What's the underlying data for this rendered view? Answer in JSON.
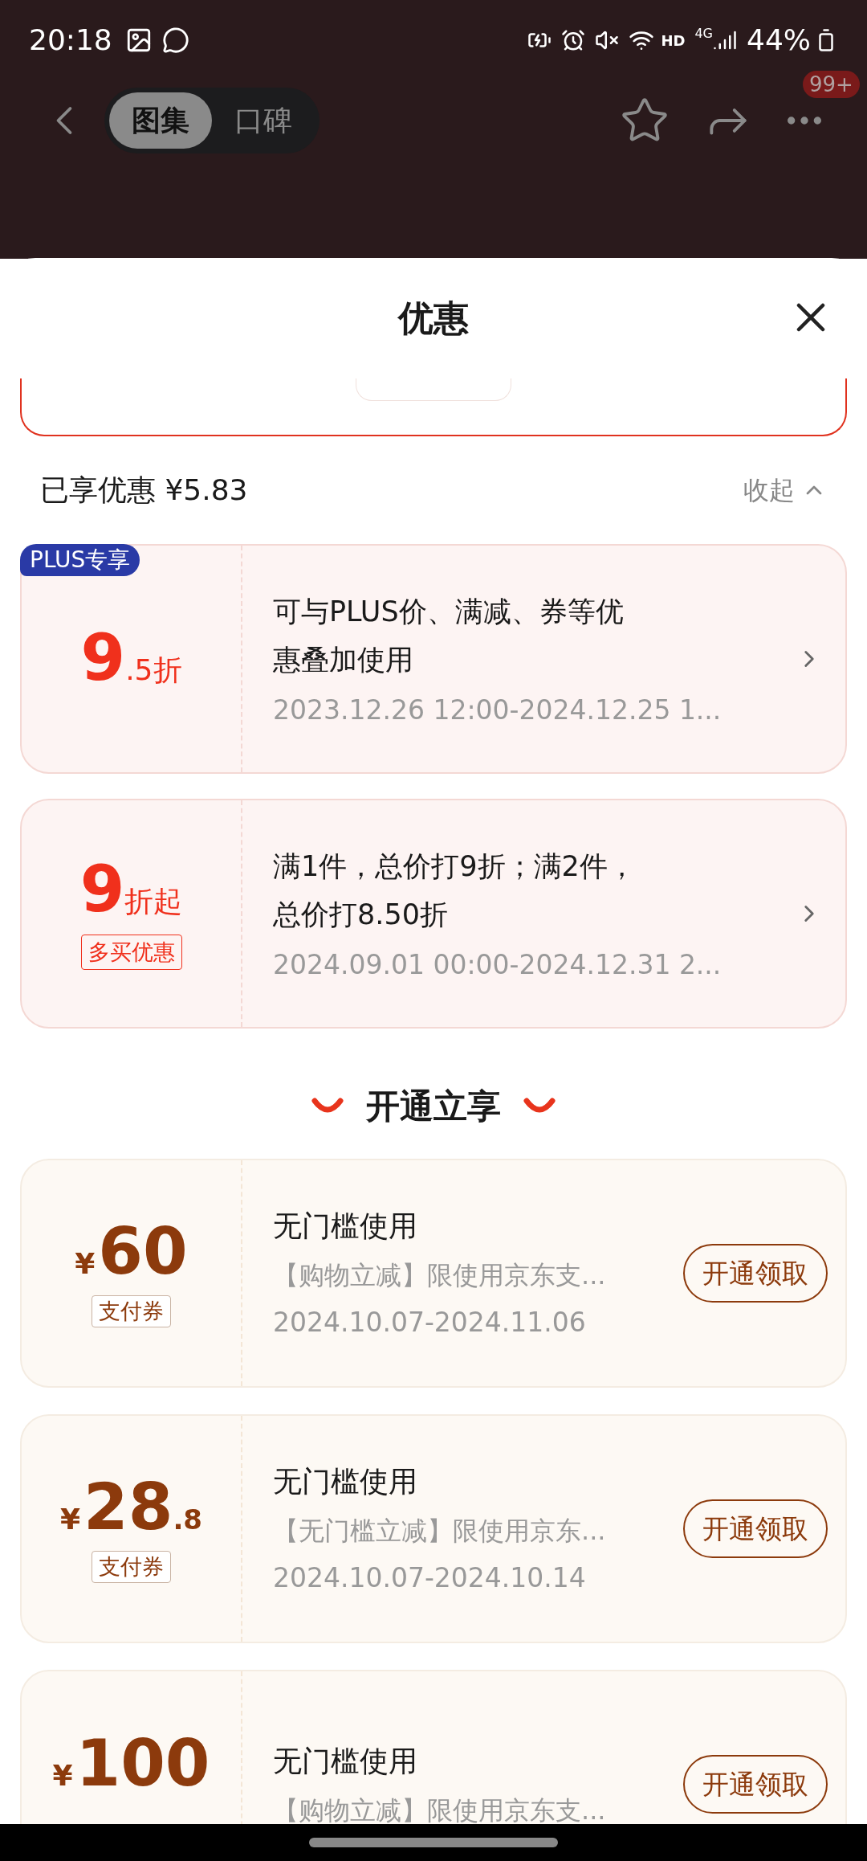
{
  "status_bar": {
    "time": "20:18",
    "hd": "HD",
    "network": "4G",
    "battery": "44%"
  },
  "nav": {
    "tabs": [
      {
        "label": "图集",
        "selected": true
      },
      {
        "label": "口碑",
        "selected": false
      }
    ],
    "badge": "99+"
  },
  "sheet": {
    "title": "优惠"
  },
  "summary": {
    "label": "已享优惠 ¥5.83",
    "toggle": "收起"
  },
  "discounts": [
    {
      "badge": "PLUS专享",
      "major": "9",
      "minor": ".5折",
      "description": "可与PLUS价、满减、券等优惠叠加使用",
      "date": "2023.12.26 12:00-2024.12.25 1..."
    },
    {
      "major": "9",
      "minor": "折起",
      "tag": "多买优惠",
      "description": "满1件，总价打9折；满2件，总价打8.50折",
      "date": "2024.09.01 00:00-2024.12.31 2..."
    }
  ],
  "section_title": "开通立享",
  "coupons": [
    {
      "currency": "¥",
      "amount": "60",
      "tag": "支付券",
      "title": "无门槛使用",
      "description": "【购物立减】限使用京东支...",
      "date": "2024.10.07-2024.11.06",
      "button": "开通领取"
    },
    {
      "currency": "¥",
      "amount": "28",
      "decimal": ".8",
      "tag": "支付券",
      "title": "无门槛使用",
      "description": "【无门槛立减】限使用京东...",
      "date": "2024.10.07-2024.10.14",
      "button": "开通领取"
    },
    {
      "currency": "¥",
      "amount": "100",
      "title": "无门槛使用",
      "description": "【购物立减】限使用京东支...",
      "button": "开通领取"
    }
  ]
}
